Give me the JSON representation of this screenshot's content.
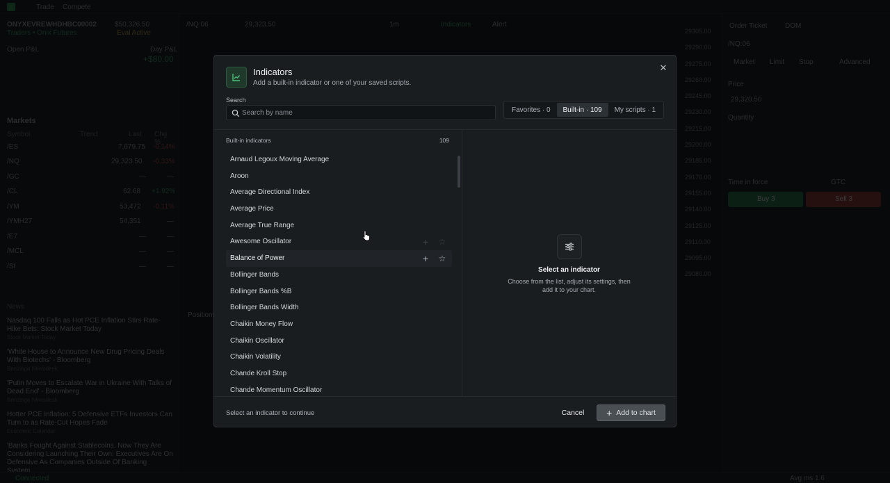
{
  "app": {
    "nav": [
      "Trade",
      "Compete"
    ],
    "account": {
      "name": "ONYXEVREWHDHBC00002",
      "sub": "Traders • Onix Futures",
      "balance": "$50,326.50",
      "status": "Eval Active"
    },
    "pnl": {
      "label": "Open P&L",
      "day_label": "Day P&L",
      "day_value": "+$80.00"
    },
    "markets": {
      "title": "Markets",
      "columns": [
        "Symbol",
        "Trend",
        "Last",
        "Chg %"
      ],
      "rows": [
        {
          "symbol": "/ES",
          "last": "7,679.75",
          "chg": "-0.14%"
        },
        {
          "symbol": "/NQ",
          "last": "29,323.50",
          "chg": "-0.33%"
        },
        {
          "symbol": "/GC",
          "last": "—",
          "chg": "—"
        },
        {
          "symbol": "/CL",
          "last": "62.68",
          "chg": "+1.92%"
        },
        {
          "symbol": "/YM",
          "last": "53,472",
          "chg": "-0.11%"
        },
        {
          "symbol": "/YMH27",
          "last": "54,351",
          "chg": "—"
        },
        {
          "symbol": "/E7",
          "last": "—",
          "chg": "—"
        },
        {
          "symbol": "/MCL",
          "last": "—",
          "chg": "—"
        },
        {
          "symbol": "/SI",
          "last": "—",
          "chg": "—"
        }
      ]
    },
    "news": {
      "title": "News",
      "items": [
        {
          "headline": "Nasdaq 100 Falls as Hot PCE Inflation Stirs Rate-Hike Bets: Stock Market Today",
          "meta": "Stock Market Today"
        },
        {
          "headline": "'White House to Announce New Drug Pricing Deals With Biotechs' - Bloomberg",
          "meta": "Benzinga Newsdesk"
        },
        {
          "headline": "'Putin Moves to Escalate War in Ukraine With Talks of Dead End' - Bloomberg",
          "meta": "Benzinga Newsdesk"
        },
        {
          "headline": "Hotter PCE Inflation: 5 Defensive ETFs Investors Can Turn to as Rate-Cut Hopes Fade",
          "meta": "Economic Calendar"
        },
        {
          "headline": "'Banks Fought Against Stablecoins. Now They Are Considering Launching Their Own: Executives Are On Defensive As Companies Outside Of Banking System...",
          "meta": ""
        }
      ]
    },
    "chart": {
      "symbol": "/NQ:06",
      "price": "29,323.50",
      "interval": "1m",
      "indicators_btn": "Indicators",
      "alert_btn": "Alert",
      "positions_tab": "Positions",
      "price_scale": [
        "29305.00",
        "29290.00",
        "29275.00",
        "29260.00",
        "29245.00",
        "29230.00",
        "29215.00",
        "29200.00",
        "29185.00",
        "29170.00",
        "29155.00",
        "29140.00",
        "29125.00",
        "29110.00",
        "29095.00",
        "29080.00"
      ]
    },
    "order_ticket": {
      "tabs": [
        "Order Ticket",
        "DOM"
      ],
      "symbol": "/NQ:06",
      "order_types": [
        "Market",
        "Limit",
        "Stop",
        "Advanced"
      ],
      "price_label": "Price",
      "price_value": "29,320.50",
      "qty_label": "Quantity",
      "tif_label": "Time in force",
      "tif_value": "GTC",
      "buy": "Buy 3",
      "sell": "Sell 3"
    },
    "status": {
      "left": "Connected",
      "right": "Avg ms 1.6"
    }
  },
  "modal": {
    "title": "Indicators",
    "subtitle": "Add a built-in indicator or one of your saved scripts.",
    "search_label": "Search",
    "search_placeholder": "Search by name",
    "tabs": [
      {
        "label": "Favorites · 0",
        "active": false
      },
      {
        "label": "Built-in · 109",
        "active": true
      },
      {
        "label": "My scripts · 1",
        "active": false
      }
    ],
    "list_header": "Built-in indicators",
    "list_count": "109",
    "indicators": [
      "Arnaud Legoux Moving Average",
      "Aroon",
      "Average Directional Index",
      "Average Price",
      "Average True Range",
      "Awesome Oscillator",
      "Balance of Power",
      "Bollinger Bands",
      "Bollinger Bands %B",
      "Bollinger Bands Width",
      "Chaikin Money Flow",
      "Chaikin Oscillator",
      "Chaikin Volatility",
      "Chande Kroll Stop",
      "Chande Momentum Oscillator"
    ],
    "hovered_index": 6,
    "empty_title": "Select an indicator",
    "empty_desc": "Choose from the list, adjust its settings, then add it to your chart.",
    "footer_hint": "Select an indicator to continue",
    "cancel_label": "Cancel",
    "add_label": "Add to chart",
    "accent": "#2f9e5c"
  }
}
